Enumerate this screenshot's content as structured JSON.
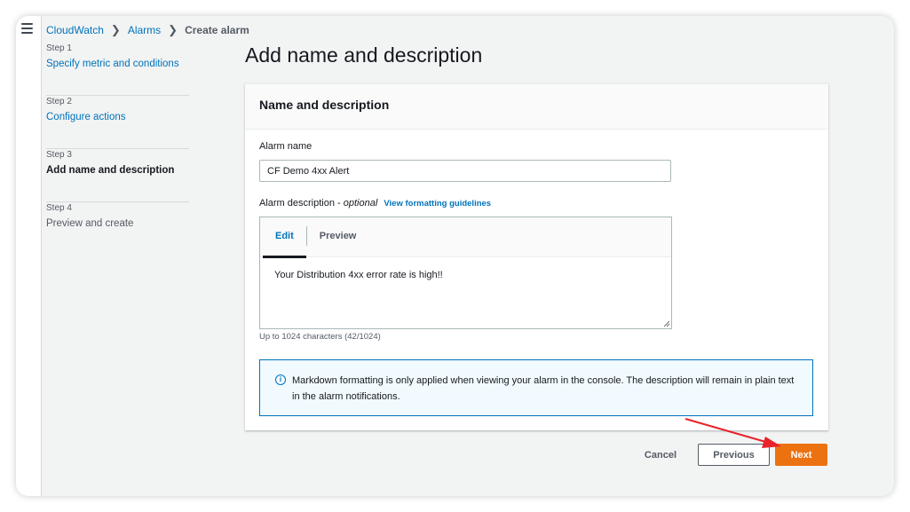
{
  "breadcrumb": {
    "items": [
      "CloudWatch",
      "Alarms"
    ],
    "current": "Create alarm"
  },
  "steps": [
    {
      "num": "Step 1",
      "label": "Specify metric and conditions",
      "state": "link"
    },
    {
      "num": "Step 2",
      "label": "Configure actions",
      "state": "link"
    },
    {
      "num": "Step 3",
      "label": "Add name and description",
      "state": "active"
    },
    {
      "num": "Step 4",
      "label": "Preview and create",
      "state": "disabled"
    }
  ],
  "page_title": "Add name and description",
  "panel": {
    "title": "Name and description",
    "alarm_name_label": "Alarm name",
    "alarm_name_value": "CF Demo 4xx Alert",
    "description_label": "Alarm description - ",
    "description_optional": "optional",
    "formatting_link": "View formatting guidelines",
    "tabs": [
      "Edit",
      "Preview"
    ],
    "active_tab": "Edit",
    "description_value": "Your Distribution 4xx error rate is high!!",
    "char_count": "Up to 1024 characters (42/1024)",
    "info_text": "Markdown formatting is only applied when viewing your alarm in the console. The description will remain in plain text in the alarm notifications."
  },
  "actions": {
    "cancel": "Cancel",
    "previous": "Previous",
    "next": "Next"
  },
  "colors": {
    "link": "#0073bb",
    "primary_button": "#ec7211",
    "annotation_arrow": "#e8232b"
  }
}
